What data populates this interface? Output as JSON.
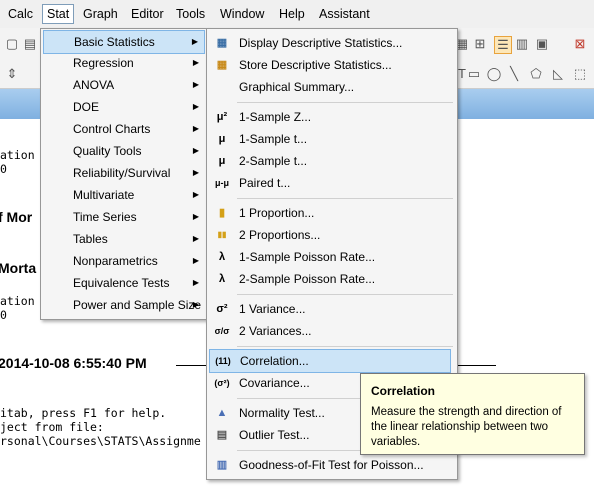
{
  "menubar": {
    "items": [
      "Calc",
      "Stat",
      "Graph",
      "Editor",
      "Tools",
      "Window",
      "Help",
      "Assistant"
    ],
    "active": "Stat"
  },
  "session": {
    "line1": "ation",
    "line2": "0",
    "heading1": "f Mor",
    "heading2": "Morta",
    "line3": "ation",
    "line4": "0",
    "timestamp": "2014-10-08 6:55:40 PM",
    "line5": "itab, press F1 for help.",
    "line6": "ject from file:",
    "line7": "rsonal\\Courses\\STATS\\Assignme"
  },
  "stat_menu": {
    "items": [
      "Basic Statistics",
      "Regression",
      "ANOVA",
      "DOE",
      "Control Charts",
      "Quality Tools",
      "Reliability/Survival",
      "Multivariate",
      "Time Series",
      "Tables",
      "Nonparametrics",
      "Equivalence Tests",
      "Power and Sample Size"
    ]
  },
  "basic_menu": {
    "items": [
      {
        "label": "Display Descriptive Statistics...",
        "icon": "table-icon"
      },
      {
        "label": "Store Descriptive Statistics...",
        "icon": "store-table-icon"
      },
      {
        "label": "Graphical Summary...",
        "icon": ""
      },
      {
        "label": "1-Sample Z...",
        "icon": "mu-sigma-icon",
        "glyph": "μ²"
      },
      {
        "label": "1-Sample t...",
        "icon": "mu-icon",
        "glyph": "μ"
      },
      {
        "label": "2-Sample t...",
        "icon": "mu-two-icon",
        "glyph": "μ"
      },
      {
        "label": "Paired t...",
        "icon": "mu-minus-mu-icon",
        "glyph": "μ-μ"
      },
      {
        "label": "1 Proportion...",
        "icon": "proportion-icon",
        "glyph": "▮"
      },
      {
        "label": "2 Proportions...",
        "icon": "proportions-icon",
        "glyph": "▮▮"
      },
      {
        "label": "1-Sample Poisson Rate...",
        "icon": "lambda-icon",
        "glyph": "λ"
      },
      {
        "label": "2-Sample Poisson Rate...",
        "icon": "lambda-two-icon",
        "glyph": "λ"
      },
      {
        "label": "1 Variance...",
        "icon": "sigma-squared-icon",
        "glyph": "σ²"
      },
      {
        "label": "2 Variances...",
        "icon": "sigma-ratio-icon",
        "glyph": "σ/σ"
      },
      {
        "label": "Correlation...",
        "icon": "correlation-icon",
        "glyph": "(11)"
      },
      {
        "label": "Covariance...",
        "icon": "covariance-icon",
        "glyph": "(σ²)"
      },
      {
        "label": "Normality Test...",
        "icon": "normality-icon",
        "glyph": "▲"
      },
      {
        "label": "Outlier Test...",
        "icon": "outlier-icon",
        "glyph": "▤"
      },
      {
        "label": "Goodness-of-Fit Test for Poisson...",
        "icon": "poisson-fit-icon",
        "glyph": "▥"
      }
    ],
    "selected": "Correlation..."
  },
  "tooltip": {
    "title": "Correlation",
    "text": "Measure the strength and direction of the linear relationship between two variables."
  },
  "colors": {
    "menu_highlight": "#cce4f7",
    "menu_highlight_border": "#7fb5e6",
    "tooltip_bg": "#ffffe1",
    "blue_bar": "#8fbbe6"
  }
}
